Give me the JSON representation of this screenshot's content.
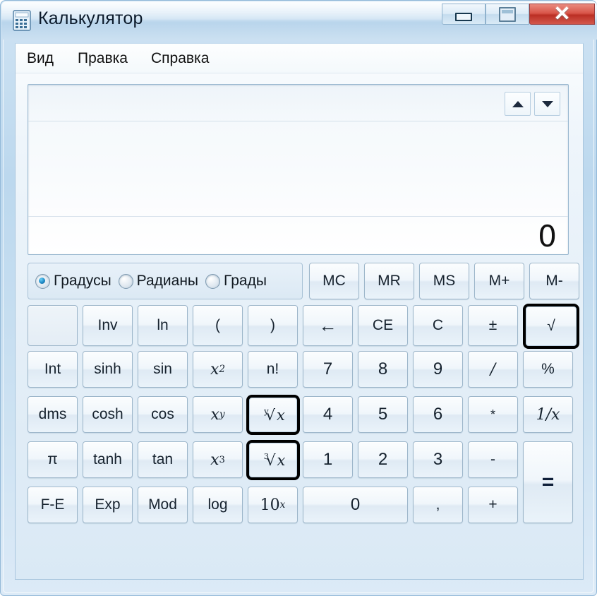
{
  "window": {
    "title": "Калькулятор",
    "icon": "calculator-icon",
    "controls": {
      "minimize": "minimize-icon",
      "maximize": "restore-icon",
      "close": "✕"
    }
  },
  "menu": {
    "items": [
      {
        "label": "Вид"
      },
      {
        "label": "Правка"
      },
      {
        "label": "Справка"
      }
    ]
  },
  "display": {
    "value": "0",
    "history": "",
    "scroll_up": "scroll-up-icon",
    "scroll_down": "scroll-down-icon"
  },
  "angle_mode": {
    "options": [
      {
        "label": "Градусы",
        "selected": true
      },
      {
        "label": "Радианы",
        "selected": false
      },
      {
        "label": "Грады",
        "selected": false
      }
    ]
  },
  "memory_buttons": [
    {
      "label": "MC"
    },
    {
      "label": "MR"
    },
    {
      "label": "MS"
    },
    {
      "label": "M+"
    },
    {
      "label": "M-"
    }
  ],
  "keypad": {
    "row2": [
      {
        "label": "",
        "blank": true
      },
      {
        "label": "Inv"
      },
      {
        "label": "ln"
      },
      {
        "label": "("
      },
      {
        "label": ")"
      },
      {
        "label": "←"
      },
      {
        "label": "CE"
      },
      {
        "label": "C"
      },
      {
        "label": "±"
      },
      {
        "label": "√",
        "highlight": true
      }
    ],
    "row3": [
      {
        "label": "Int"
      },
      {
        "label": "sinh"
      },
      {
        "label": "sin"
      },
      {
        "label": "x2",
        "base": "x",
        "sup": "2",
        "italic": true
      },
      {
        "label": "n!"
      },
      {
        "label": "7",
        "num": true
      },
      {
        "label": "8",
        "num": true
      },
      {
        "label": "9",
        "num": true
      },
      {
        "label": "/"
      },
      {
        "label": "%"
      }
    ],
    "row4": [
      {
        "label": "dms"
      },
      {
        "label": "cosh"
      },
      {
        "label": "cos"
      },
      {
        "label": "xy",
        "base": "x",
        "sup": "y",
        "italic": true
      },
      {
        "label": "y√x",
        "radical": true,
        "index": "y",
        "highlight": true
      },
      {
        "label": "4",
        "num": true
      },
      {
        "label": "5",
        "num": true
      },
      {
        "label": "6",
        "num": true
      },
      {
        "label": "*"
      },
      {
        "label": "1/x",
        "italic": true
      }
    ],
    "row5": [
      {
        "label": "π"
      },
      {
        "label": "tanh"
      },
      {
        "label": "tan"
      },
      {
        "label": "x3",
        "base": "x",
        "sup": "3",
        "italic": true
      },
      {
        "label": "3√x",
        "radical": true,
        "index": "3",
        "highlight": true
      },
      {
        "label": "1",
        "num": true
      },
      {
        "label": "2",
        "num": true
      },
      {
        "label": "3",
        "num": true
      },
      {
        "label": "-"
      }
    ],
    "row6": [
      {
        "label": "F-E"
      },
      {
        "label": "Exp"
      },
      {
        "label": "Mod"
      },
      {
        "label": "log"
      },
      {
        "label": "10x",
        "base": "10",
        "sup": "x",
        "italic": true
      },
      {
        "label": "0",
        "num": true,
        "wide": true
      },
      {
        "label": ","
      },
      {
        "label": "+"
      }
    ],
    "equals": {
      "label": "="
    }
  },
  "colors": {
    "window_frame": "#bcd8ee",
    "close_button": "#bb2f24",
    "radio_accent": "#1f8ac7",
    "highlight_border": "#000000",
    "text": "#16222e"
  }
}
